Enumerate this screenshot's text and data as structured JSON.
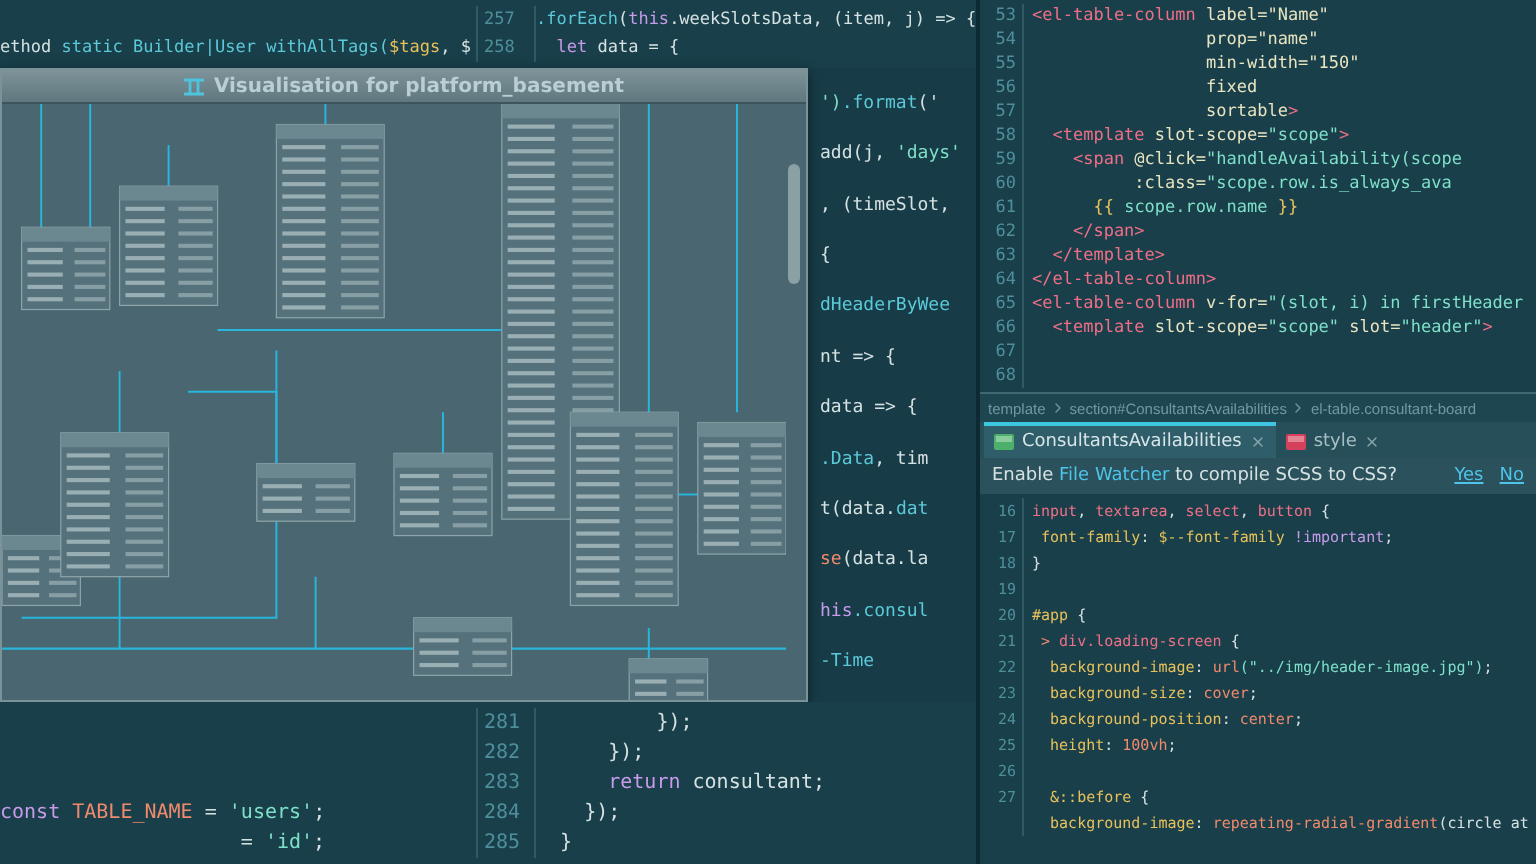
{
  "left_editor": {
    "top_lines": [
      [
        {
          "kind": "plain",
          "text": "ethod "
        },
        {
          "kind": "function",
          "text": "static Builder|User withAllTags("
        },
        {
          "kind": "variable",
          "text": "$tags"
        },
        {
          "kind": "plain",
          "text": ", $"
        }
      ]
    ],
    "bottom_lines": [
      [
        {
          "kind": "keyword",
          "text": "const "
        },
        {
          "kind": "value",
          "text": "TABLE_NAME"
        },
        {
          "kind": "plain",
          "text": " = "
        },
        {
          "kind": "string",
          "text": "'users'"
        },
        {
          "kind": "plain",
          "text": ";"
        }
      ],
      [
        {
          "kind": "plain",
          "text": "                    = "
        },
        {
          "kind": "string",
          "text": "'id'"
        },
        {
          "kind": "plain",
          "text": ";"
        }
      ]
    ]
  },
  "middle_editor": {
    "top_lines": [
      {
        "number": "257",
        "tokens": [
          {
            "kind": "function",
            "text": ".forEach"
          },
          {
            "kind": "plain",
            "text": "("
          },
          {
            "kind": "keyword",
            "text": "this"
          },
          {
            "kind": "plain",
            "text": ".weekSlotsData, (item, j) => {"
          }
        ]
      },
      {
        "number": "258",
        "tokens": [
          {
            "kind": "keyword",
            "text": "  let"
          },
          {
            "kind": "plain",
            "text": " data = {"
          }
        ]
      }
    ],
    "fragments": [
      [
        {
          "kind": "string",
          "text": "')"
        },
        {
          "kind": "function",
          "text": ".format"
        },
        {
          "kind": "plain",
          "text": "('"
        }
      ],
      [
        {
          "kind": "plain",
          "text": "add(j, "
        },
        {
          "kind": "string",
          "text": "'days'"
        }
      ],
      [
        {
          "kind": "plain",
          "text": ", (timeSlot,"
        }
      ],
      [
        {
          "kind": "plain",
          "text": "{"
        }
      ],
      [
        {
          "kind": "function",
          "text": "dHeaderByWee"
        }
      ],
      [
        {
          "kind": "plain",
          "text": "nt => {"
        }
      ],
      [
        {
          "kind": "plain",
          "text": "data => {"
        }
      ],
      [
        {
          "kind": "function",
          "text": ".Data"
        },
        {
          "kind": "plain",
          "text": ", tim"
        }
      ],
      [
        {
          "kind": "plain",
          "text": "t(data."
        },
        {
          "kind": "function",
          "text": "dat"
        }
      ],
      [
        {
          "kind": "value",
          "text": "se"
        },
        {
          "kind": "plain",
          "text": "(data.la"
        }
      ],
      [
        {
          "kind": "keyword",
          "text": "his"
        },
        {
          "kind": "function",
          "text": ".consul"
        }
      ],
      [
        {
          "kind": "function",
          "text": "-Time"
        }
      ]
    ],
    "bottom_lines": [
      {
        "number": "281",
        "tokens": [
          {
            "kind": "plain",
            "text": "          });"
          }
        ]
      },
      {
        "number": "282",
        "tokens": [
          {
            "kind": "plain",
            "text": "      });"
          }
        ]
      },
      {
        "number": "283",
        "tokens": [
          {
            "kind": "keyword",
            "text": "      return"
          },
          {
            "kind": "plain",
            "text": " consultant;"
          }
        ]
      },
      {
        "number": "284",
        "tokens": [
          {
            "kind": "plain",
            "text": "    });"
          }
        ]
      },
      {
        "number": "285",
        "tokens": [
          {
            "kind": "plain",
            "text": "  }"
          }
        ]
      }
    ]
  },
  "diagram_window": {
    "title": "Visualisation for platform_basement"
  },
  "top_editor": {
    "lines": [
      {
        "number": "53",
        "tokens": [
          {
            "kind": "tag",
            "text": "<el-table-column"
          },
          {
            "kind": "attr",
            "text": " label="
          },
          {
            "kind": "attr",
            "text": "\"Name\""
          }
        ]
      },
      {
        "number": "54",
        "tokens": [
          {
            "kind": "attr",
            "text": "                 prop=\"name\""
          }
        ]
      },
      {
        "number": "55",
        "tokens": [
          {
            "kind": "attr",
            "text": "                 min-width=\"150\""
          }
        ]
      },
      {
        "number": "56",
        "tokens": [
          {
            "kind": "attr",
            "text": "                 fixed"
          }
        ]
      },
      {
        "number": "57",
        "tokens": [
          {
            "kind": "attr",
            "text": "                 sortable"
          },
          {
            "kind": "tag",
            "text": ">"
          }
        ]
      },
      {
        "number": "58",
        "tokens": [
          {
            "kind": "tag",
            "text": "  <template"
          },
          {
            "kind": "attr",
            "text": " slot-scope="
          },
          {
            "kind": "string",
            "text": "\"scope\""
          },
          {
            "kind": "tag",
            "text": ">"
          }
        ]
      },
      {
        "number": "59",
        "tokens": [
          {
            "kind": "tag",
            "text": "    <span"
          },
          {
            "kind": "attr",
            "text": " @click="
          },
          {
            "kind": "string",
            "text": "\"handleAvailability(scope"
          }
        ]
      },
      {
        "number": "60",
        "tokens": [
          {
            "kind": "attr",
            "text": "          :class="
          },
          {
            "kind": "string",
            "text": "\"scope.row.is_always_ava"
          }
        ]
      },
      {
        "number": "61",
        "tokens": [
          {
            "kind": "variable",
            "text": "      {{"
          },
          {
            "kind": "string",
            "text": " scope.row.name "
          },
          {
            "kind": "variable",
            "text": "}}"
          }
        ]
      },
      {
        "number": "62",
        "tokens": [
          {
            "kind": "tag",
            "text": "    </span>"
          }
        ]
      },
      {
        "number": "63",
        "tokens": [
          {
            "kind": "tag",
            "text": "  </template>"
          }
        ]
      },
      {
        "number": "64",
        "tokens": [
          {
            "kind": "tag",
            "text": "</el-table-column>"
          }
        ]
      },
      {
        "number": "65",
        "tokens": [
          {
            "kind": "tag",
            "text": "<el-table-column"
          },
          {
            "kind": "attr",
            "text": " v-for="
          },
          {
            "kind": "string",
            "text": "\"(slot, i) in firstHeader"
          }
        ]
      },
      {
        "number": "66",
        "tokens": [
          {
            "kind": "tag",
            "text": "  <template"
          },
          {
            "kind": "attr",
            "text": " slot-scope="
          },
          {
            "kind": "string",
            "text": "\"scope\""
          },
          {
            "kind": "attr",
            "text": " slot="
          },
          {
            "kind": "string",
            "text": "\"header\""
          },
          {
            "kind": "tag",
            "text": ">"
          }
        ]
      },
      {
        "number": "67"
      },
      {
        "number": "68"
      }
    ]
  },
  "breadcrumb": [
    "template",
    "section#ConsultantsAvailabilities",
    "el-table.consultant-board"
  ],
  "tabs": [
    {
      "label": "ConsultantsAvailabilities",
      "kind": "vue",
      "selected": true
    },
    {
      "label": "style",
      "kind": "scss",
      "selected": false
    }
  ],
  "notification": {
    "message": [
      {
        "kind": "plain",
        "text": "Enable "
      },
      {
        "kind": "link",
        "text": "File Watcher"
      },
      {
        "kind": "plain",
        "text": " to compile SCSS to CSS?"
      }
    ],
    "actions": [
      "Yes",
      "No"
    ]
  },
  "style_editor": {
    "lines": [
      {
        "number": "16",
        "tokens": [
          {
            "kind": "tag",
            "text": "input"
          },
          {
            "kind": "plain",
            "text": ", "
          },
          {
            "kind": "tag",
            "text": "textarea"
          },
          {
            "kind": "plain",
            "text": ", "
          },
          {
            "kind": "tag",
            "text": "select"
          },
          {
            "kind": "plain",
            "text": ", "
          },
          {
            "kind": "tag",
            "text": "button"
          },
          {
            "kind": "plain",
            "text": " {"
          }
        ]
      },
      {
        "number": "17",
        "tokens": [
          {
            "kind": "property",
            "text": " font-family"
          },
          {
            "kind": "plain",
            "text": ": "
          },
          {
            "kind": "property",
            "text": "$--font-family "
          },
          {
            "kind": "keyword",
            "text": "!important"
          },
          {
            "kind": "plain",
            "text": ";"
          }
        ]
      },
      {
        "number": "18",
        "tokens": [
          {
            "kind": "plain",
            "text": "}"
          }
        ]
      },
      {
        "number": "19"
      },
      {
        "number": "20",
        "tokens": [
          {
            "kind": "property",
            "text": "#app"
          },
          {
            "kind": "plain",
            "text": " {"
          }
        ]
      },
      {
        "number": "21",
        "tokens": [
          {
            "kind": "value",
            "text": " > "
          },
          {
            "kind": "tag",
            "text": "div.loading-screen"
          },
          {
            "kind": "plain",
            "text": " {"
          }
        ]
      },
      {
        "number": "22",
        "tokens": [
          {
            "kind": "property",
            "text": "  background-image"
          },
          {
            "kind": "plain",
            "text": ": "
          },
          {
            "kind": "value",
            "text": "url"
          },
          {
            "kind": "string",
            "text": "(\"../img/header-image.jpg\")"
          },
          {
            "kind": "plain",
            "text": ";"
          }
        ]
      },
      {
        "number": "23",
        "tokens": [
          {
            "kind": "property",
            "text": "  background-size"
          },
          {
            "kind": "plain",
            "text": ": "
          },
          {
            "kind": "value",
            "text": "cover"
          },
          {
            "kind": "plain",
            "text": ";"
          }
        ]
      },
      {
        "number": "24",
        "tokens": [
          {
            "kind": "property",
            "text": "  background-position"
          },
          {
            "kind": "plain",
            "text": ": "
          },
          {
            "kind": "value",
            "text": "center"
          },
          {
            "kind": "plain",
            "text": ";"
          }
        ]
      },
      {
        "number": "25",
        "tokens": [
          {
            "kind": "property",
            "text": "  height"
          },
          {
            "kind": "plain",
            "text": ": "
          },
          {
            "kind": "value",
            "text": "100vh"
          },
          {
            "kind": "plain",
            "text": ";"
          }
        ]
      },
      {
        "number": "26"
      },
      {
        "number": "27",
        "tokens": [
          {
            "kind": "property",
            "text": "  &::before"
          },
          {
            "kind": "plain",
            "text": " {"
          }
        ]
      },
      {
        "tokens": [
          {
            "kind": "property",
            "text": "  background-image"
          },
          {
            "kind": "plain",
            "text": ": "
          },
          {
            "kind": "value",
            "text": "repeating-radial-gradient"
          },
          {
            "kind": "plain",
            "text": "(circle at"
          }
        ]
      }
    ]
  }
}
